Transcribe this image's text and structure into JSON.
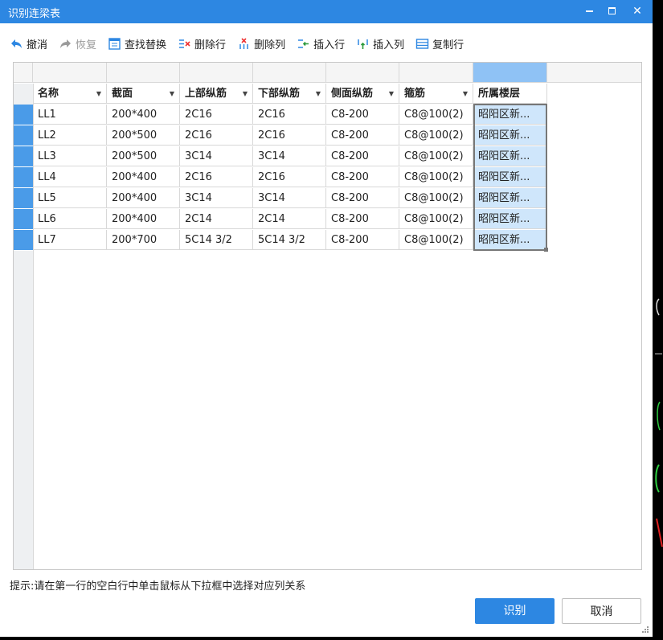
{
  "window": {
    "title": "识别连梁表",
    "minimize_glyph": "",
    "maximize_glyph": "",
    "close_glyph": "✕"
  },
  "toolbar": {
    "items": [
      {
        "label": "撤消",
        "icon": "undo-icon",
        "enabled": true
      },
      {
        "label": "恢复",
        "icon": "redo-icon",
        "enabled": false
      },
      {
        "label": "查找替换",
        "icon": "find-replace-icon",
        "enabled": true
      },
      {
        "label": "删除行",
        "icon": "delete-row-icon",
        "enabled": true
      },
      {
        "label": "删除列",
        "icon": "delete-column-icon",
        "enabled": true
      },
      {
        "label": "插入行",
        "icon": "insert-row-icon",
        "enabled": true
      },
      {
        "label": "插入列",
        "icon": "insert-column-icon",
        "enabled": true
      },
      {
        "label": "复制行",
        "icon": "copy-row-icon",
        "enabled": true
      }
    ]
  },
  "table": {
    "columns": [
      "名称",
      "截面",
      "上部纵筋",
      "下部纵筋",
      "侧面纵筋",
      "箍筋",
      "所属楼层"
    ],
    "rows": [
      [
        "LL1",
        "200*400",
        "2C16",
        "2C16",
        "C8-200",
        "C8@100(2)",
        "昭阳区新..."
      ],
      [
        "LL2",
        "200*500",
        "2C16",
        "2C16",
        "C8-200",
        "C8@100(2)",
        "昭阳区新..."
      ],
      [
        "LL3",
        "200*500",
        "3C14",
        "3C14",
        "C8-200",
        "C8@100(2)",
        "昭阳区新..."
      ],
      [
        "LL4",
        "200*400",
        "2C16",
        "2C16",
        "C8-200",
        "C8@100(2)",
        "昭阳区新..."
      ],
      [
        "LL5",
        "200*400",
        "3C14",
        "3C14",
        "C8-200",
        "C8@100(2)",
        "昭阳区新..."
      ],
      [
        "LL6",
        "200*400",
        "2C14",
        "2C14",
        "C8-200",
        "C8@100(2)",
        "昭阳区新..."
      ],
      [
        "LL7",
        "200*700",
        "5C14 3/2",
        "5C14 3/2",
        "C8-200",
        "C8@100(2)",
        "昭阳区新..."
      ]
    ]
  },
  "hint": "提示:请在第一行的空白行中单击鼠标从下拉框中选择对应列关系",
  "buttons": {
    "recognize": "识别",
    "cancel": "取消"
  },
  "colors": {
    "accent": "#2d87e2",
    "row_header": "#4a9be8",
    "selected_cell": "#cfe6fb"
  }
}
